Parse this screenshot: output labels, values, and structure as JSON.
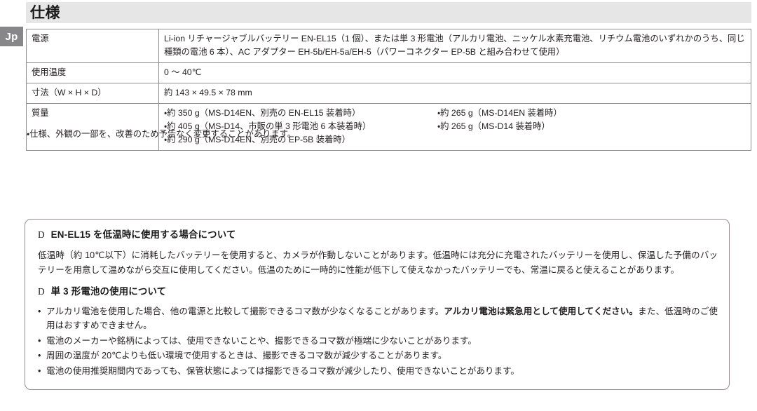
{
  "lang_tab": {
    "label": "Jp"
  },
  "section": {
    "title": "仕様"
  },
  "spec_table": {
    "rows": [
      {
        "label": "電源",
        "value": "Li-ion リチャージャブルバッテリー EN-EL15（1 個）、または単 3 形電池（アルカリ電池、ニッケル水素充電池、リチウム電池のいずれかのうち、同じ種類の電池 6 本）、AC アダプター EH-5b/EH-5a/EH-5（パワーコネクター EP-5B と組み合わせて使用）"
      },
      {
        "label": "使用温度",
        "value": "0 〜 40℃"
      },
      {
        "label": "寸法（W × H × D）",
        "value": "約 143 × 49.5 × 78 mm"
      },
      {
        "label": "質量",
        "col_a": [
          "・約 350 g（MS-D14EN、別売の EN-EL15 装着時）",
          "・約 405 g（MS-D14、市販の単 3 形電池 6 本装着時）",
          "・約 290 g（MS-D14EN、別売の EP-5B 装着時）"
        ],
        "col_b": [
          "・約 265 g（MS-D14EN 装着時）",
          "・約 265 g（MS-D14 装着時）"
        ]
      }
    ]
  },
  "table_note": "・仕様、外観の一部を、改善のため予告なく変更することがあります。",
  "caution_box": {
    "heading_1_marker": "D",
    "heading_1": "EN-EL15 を低温時に使用する場合について",
    "paragraph_1": "低温時（約 10℃以下）に消耗したバッテリーを使用すると、カメラが作動しないことがあります。低温時には充分に充電されたバッテリーを使用し、保温した予備のバッテリーを用意して温めながら交互に使用してください。低温のために一時的に性能が低下して使えなかったバッテリーでも、常温に戻ると使えることがあります。",
    "heading_2_marker": "D",
    "heading_2": "単 3 形電池の使用について",
    "bullets": [
      {
        "bullet": "•",
        "text_before": "アルカリ電池を使用した場合、他の電源と比較して撮影できるコマ数が少なくなることがあります。",
        "text_bold": "アルカリ電池は緊急用として使用してください。",
        "text_after": "また、低温時のご使用はおすすめできません。"
      },
      {
        "bullet": "•",
        "text_before": "電池のメーカーや銘柄によっては、使用できないことや、撮影できるコマ数が極端に少ないことがあります。",
        "text_bold": "",
        "text_after": ""
      },
      {
        "bullet": "•",
        "text_before": "周囲の温度が 20℃よりも低い環境で使用するときは、撮影できるコマ数が減少することがあります。",
        "text_bold": "",
        "text_after": ""
      },
      {
        "bullet": "•",
        "text_before": "電池の使用推奨期間内であっても、保管状態によっては撮影できるコマ数が減少したり、使用できないことがあります。",
        "text_bold": "",
        "text_after": ""
      }
    ]
  },
  "colors": {
    "header_band": "#e6e6e6",
    "lang_tab": "#87878a",
    "table_border": "#8e8e90",
    "caution_border": "#9a8a8e",
    "text": "#231f20"
  }
}
